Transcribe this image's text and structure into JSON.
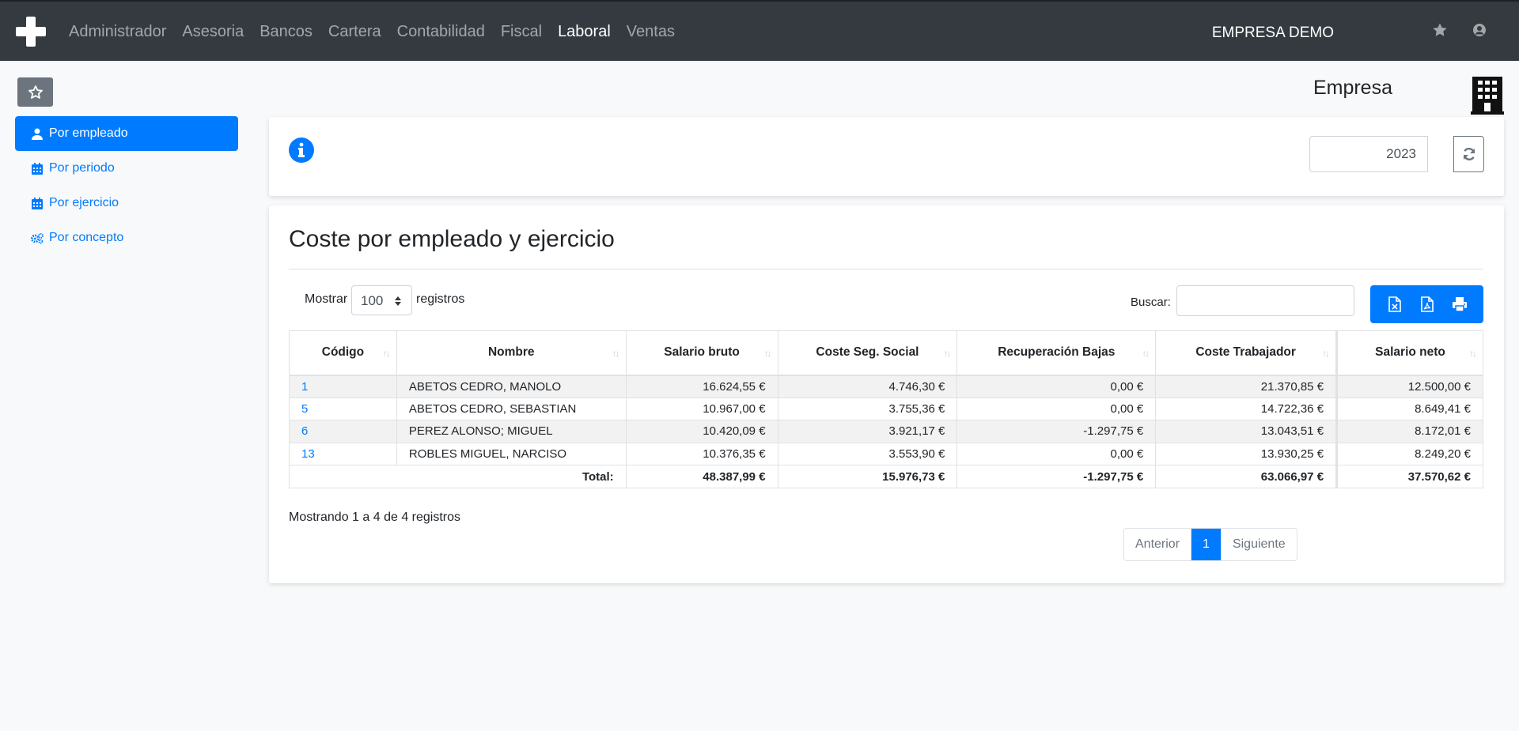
{
  "navbar": {
    "menu": [
      "Administrador",
      "Asesoria",
      "Bancos",
      "Cartera",
      "Contabilidad",
      "Fiscal",
      "Laboral",
      "Ventas"
    ],
    "active": "Laboral",
    "company": "EMPRESA DEMO"
  },
  "sidebar": {
    "items": [
      {
        "label": "Por empleado",
        "icon": "user-icon",
        "active": true
      },
      {
        "label": "Por periodo",
        "icon": "calendar-icon"
      },
      {
        "label": "Por ejercicio",
        "icon": "calendar-icon"
      },
      {
        "label": "Por concepto",
        "icon": "gears-icon"
      }
    ]
  },
  "header": {
    "empresa": "Empresa"
  },
  "filter": {
    "year": "2023"
  },
  "report": {
    "title": "Coste por empleado y ejercicio",
    "show_label": "Mostrar",
    "show_value": "100",
    "records_label": "registros",
    "search_label": "Buscar:",
    "columns": [
      "Código",
      "Nombre",
      "Salario bruto",
      "Coste Seg. Social",
      "Recuperación Bajas",
      "Coste Trabajador",
      "Salario neto"
    ],
    "rows": [
      [
        "1",
        "ABETOS CEDRO, MANOLO",
        "16.624,55 €",
        "4.746,30 €",
        "0,00 €",
        "21.370,85 €",
        "12.500,00 €"
      ],
      [
        "5",
        "ABETOS CEDRO, SEBASTIAN",
        "10.967,00 €",
        "3.755,36 €",
        "0,00 €",
        "14.722,36 €",
        "8.649,41 €"
      ],
      [
        "6",
        "PEREZ ALONSO; MIGUEL",
        "10.420,09 €",
        "3.921,17 €",
        "-1.297,75 €",
        "13.043,51 €",
        "8.172,01 €"
      ],
      [
        "13",
        "ROBLES MIGUEL, NARCISO",
        "10.376,35 €",
        "3.553,90 €",
        "0,00 €",
        "13.930,25 €",
        "8.249,20 €"
      ]
    ],
    "total_label": "Total:",
    "totals": [
      "48.387,99 €",
      "15.976,73 €",
      "-1.297,75 €",
      "63.066,97 €",
      "37.570,62 €"
    ],
    "info": "Mostrando 1 a 4 de 4 registros",
    "pager": {
      "prev": "Anterior",
      "current": "1",
      "next": "Siguiente"
    }
  },
  "colors": {
    "navbar": "#343a40",
    "primary": "#007bff",
    "secondary": "#6c757d"
  }
}
